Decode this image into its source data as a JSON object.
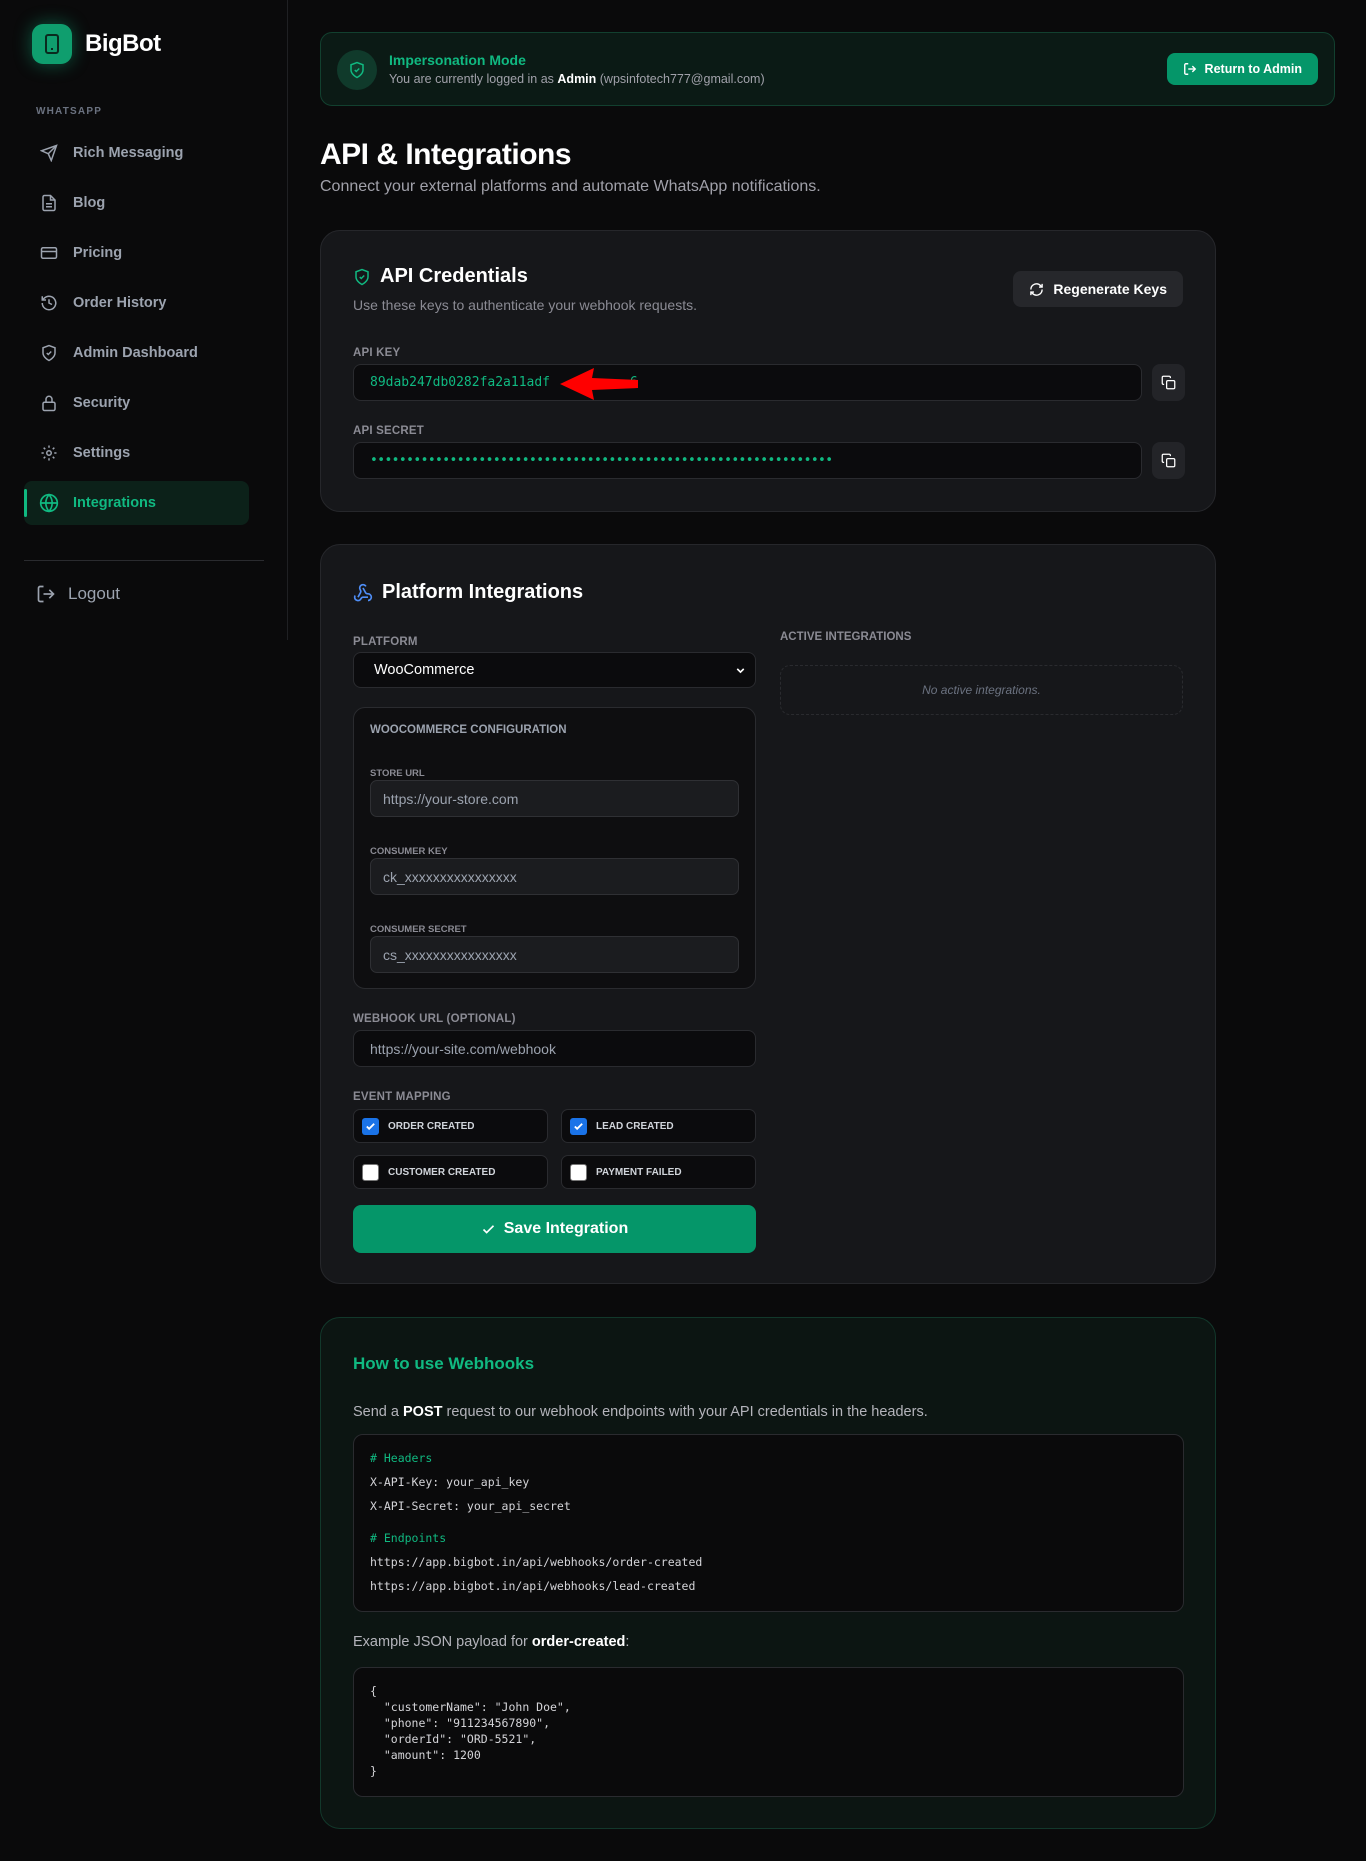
{
  "brand": {
    "name": "BigBot"
  },
  "sidebar": {
    "section_label": "WHATSAPP",
    "items": [
      {
        "label": "Rich Messaging",
        "icon": "send-icon"
      },
      {
        "label": "Blog",
        "icon": "document-icon"
      },
      {
        "label": "Pricing",
        "icon": "credit-card-icon"
      },
      {
        "label": "Order History",
        "icon": "history-icon"
      },
      {
        "label": "Admin Dashboard",
        "icon": "shield-icon"
      },
      {
        "label": "Security",
        "icon": "lock-icon"
      },
      {
        "label": "Settings",
        "icon": "gear-icon"
      },
      {
        "label": "Integrations",
        "icon": "globe-icon",
        "active": true
      }
    ],
    "logout_label": "Logout"
  },
  "banner": {
    "title": "Impersonation Mode",
    "prefix": "You are currently logged in as ",
    "user": "Admin",
    "email": " (wpsinfotech777@gmail.com)",
    "button_label": "Return to Admin"
  },
  "page": {
    "title": "API & Integrations",
    "subtitle": "Connect your external platforms and automate WhatsApp notifications."
  },
  "credentials": {
    "title": "API Credentials",
    "subtitle": "Use these keys to authenticate your webhook requests.",
    "regenerate_label": "Regenerate Keys",
    "api_key_label": "API KEY",
    "api_key_value": "89dab247db0282fa2a11adf",
    "api_key_tail": "6",
    "api_secret_label": "API SECRET",
    "api_secret_value": "••••••••••••••••••••••••••••••••••••••••••••••••••••••••••••••••"
  },
  "platform": {
    "title": "Platform Integrations",
    "platform_label": "PLATFORM",
    "platform_selected": "WooCommerce",
    "config_title": "WOOCOMMERCE CONFIGURATION",
    "store_url_label": "STORE URL",
    "store_url_placeholder": "https://your-store.com",
    "consumer_key_label": "CONSUMER KEY",
    "consumer_key_placeholder": "ck_xxxxxxxxxxxxxxxx",
    "consumer_secret_label": "CONSUMER SECRET",
    "consumer_secret_placeholder": "cs_xxxxxxxxxxxxxxxx",
    "webhook_label": "WEBHOOK URL (OPTIONAL)",
    "webhook_placeholder": "https://your-site.com/webhook",
    "event_label": "EVENT MAPPING",
    "events": [
      {
        "label": "ORDER CREATED",
        "checked": true
      },
      {
        "label": "LEAD CREATED",
        "checked": true
      },
      {
        "label": "CUSTOMER CREATED",
        "checked": false
      },
      {
        "label": "PAYMENT FAILED",
        "checked": false
      }
    ],
    "save_label": "Save Integration",
    "active_title": "ACTIVE INTEGRATIONS",
    "active_empty": "No active integrations."
  },
  "webhooks": {
    "title": "How to use Webhooks",
    "intro_prefix": "Send a ",
    "intro_method": "POST",
    "intro_suffix": " request to our webhook endpoints with your API credentials in the headers.",
    "code": {
      "headers_comment": "# Headers",
      "header1": "X-API-Key: your_api_key",
      "header2": "X-API-Secret: your_api_secret",
      "endpoints_comment": "# Endpoints",
      "endpoint1": "https://app.bigbot.in/api/webhooks/order-created",
      "endpoint2": "https://app.bigbot.in/api/webhooks/lead-created"
    },
    "example_prefix": "Example JSON payload for ",
    "example_event": "order-created",
    "example_suffix": ":",
    "payload": [
      "{",
      "  \"customerName\": \"John Doe\",",
      "  \"phone\": \"911234567890\",",
      "  \"orderId\": \"ORD-5521\",",
      "  \"amount\": 1200",
      "}"
    ]
  },
  "colors": {
    "accent": "#10b981",
    "button": "#059669",
    "background": "#0a0a0b",
    "annotation_arrow": "#ff0000"
  }
}
